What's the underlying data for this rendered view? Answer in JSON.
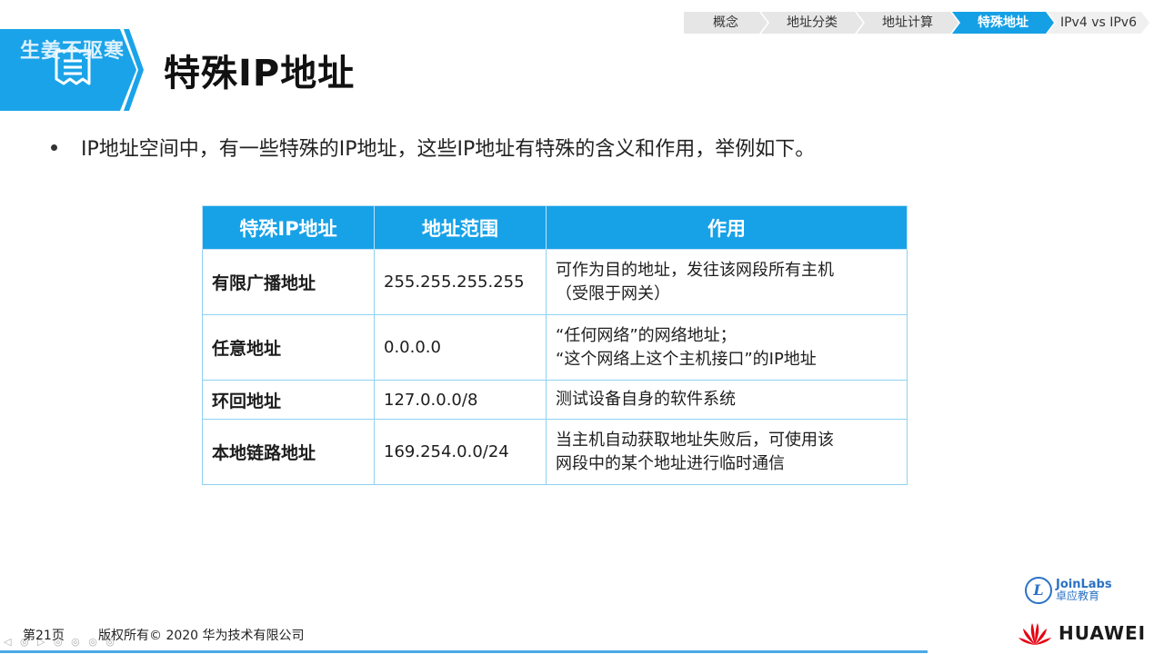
{
  "breadcrumb": [
    "概念",
    "地址分类",
    "地址计算",
    "特殊地址",
    "IPv4 vs IPv6"
  ],
  "breadcrumb_active": "特殊地址",
  "watermark": "生姜不驱寒",
  "title": "特殊IP地址",
  "bullet": "IP地址空间中，有一些特殊的IP地址，这些IP地址有特殊的含义和作用，举例如下。",
  "table": {
    "headers": [
      "特殊IP地址",
      "地址范围",
      "作用"
    ],
    "rows": [
      {
        "name": "有限广播地址",
        "range": "255.255.255.255",
        "use1": "可作为目的地址，发往该网段所有主机",
        "use2": "（受限于网关）"
      },
      {
        "name": "任意地址",
        "range": "0.0.0.0",
        "use1": "“任何网络”的网络地址；",
        "use2": "“这个网络上这个主机接口”的IP地址"
      },
      {
        "name": "环回地址",
        "range": "127.0.0.0/8",
        "use1": "测试设备自身的软件系统",
        "use2": ""
      },
      {
        "name": "本地链路地址",
        "range": "169.254.0.0/24",
        "use1": "当主机自动获取地址失败后，可使用该",
        "use2": "网段中的某个地址进行临时通信"
      }
    ]
  },
  "footer": {
    "page": "第21页",
    "copyright": "版权所有© 2020 华为技术有限公司"
  },
  "logos": {
    "joinlabs_en": "JoinLabs",
    "joinlabs_cn": "卓应教育",
    "joinlabs_mark": "L",
    "huawei": "HUAWEI"
  },
  "colors": {
    "accent": "#17a2e8",
    "huawei_red": "#e60012"
  }
}
